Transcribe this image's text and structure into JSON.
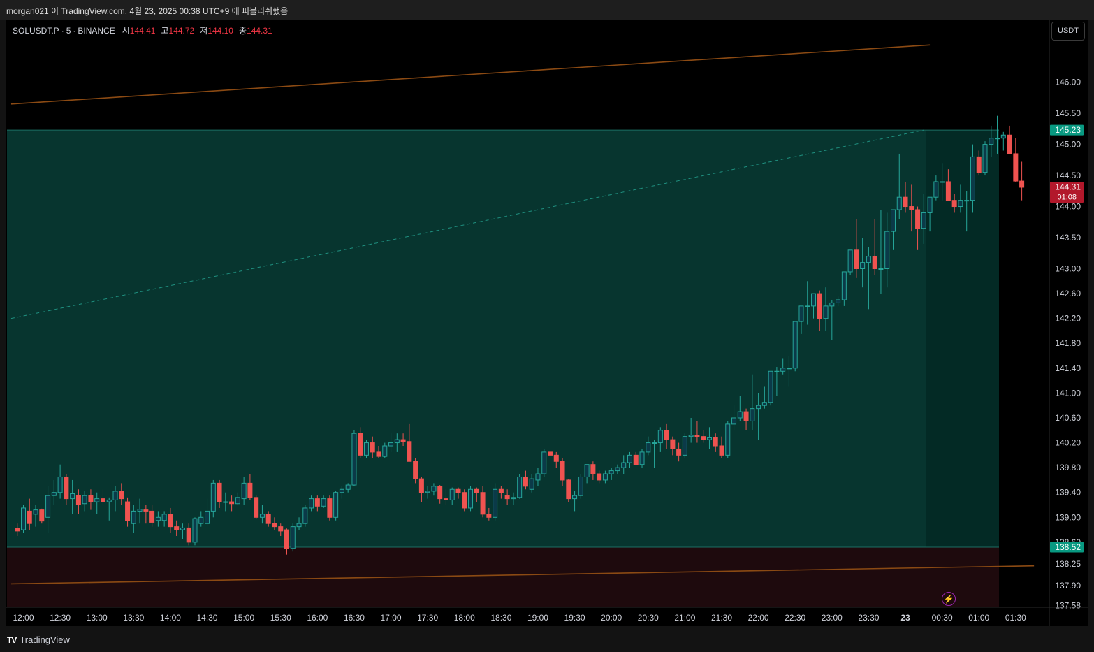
{
  "window": {
    "caption": "morgan021 이 TradingView.com, 4월 23, 2025 00:38 UTC+9 에 퍼블리쉬했음",
    "brand": "TradingView",
    "brand_logo": "TV"
  },
  "legend": {
    "symbol": "SOLUSDT.P",
    "interval": "5",
    "exchange": "BINANCE",
    "open_label": "시",
    "open": "144.41",
    "high_label": "고",
    "high": "144.72",
    "low_label": "저",
    "low": "144.10",
    "close_label": "종",
    "close": "144.31"
  },
  "toolbar": {
    "currency_label": "USDT"
  },
  "colors": {
    "up": "#26a69a",
    "down": "#ef5350",
    "profit_zone": "#07352f",
    "loss_zone": "#1e0a0d",
    "trend_line": "#8b4a13",
    "background": "#000000"
  },
  "icons": {
    "alert": "lightning-icon"
  },
  "chart_data": {
    "type": "candlestick",
    "symbol": "SOLUSDT.P",
    "interval_minutes": 5,
    "y_ticks": [
      "146.00",
      "145.50",
      "145.00",
      "144.50",
      "144.00",
      "143.50",
      "143.00",
      "142.60",
      "142.20",
      "141.80",
      "141.40",
      "141.00",
      "140.60",
      "140.20",
      "139.80",
      "139.40",
      "139.00",
      "138.60",
      "138.25",
      "137.90",
      "137.58"
    ],
    "x_ticks": [
      "12:00",
      "12:30",
      "13:00",
      "13:30",
      "14:00",
      "14:30",
      "15:00",
      "15:30",
      "16:00",
      "16:30",
      "17:00",
      "17:30",
      "18:00",
      "18:30",
      "19:00",
      "19:30",
      "20:00",
      "20:30",
      "21:00",
      "21:30",
      "22:00",
      "22:30",
      "23:00",
      "23:30",
      "23",
      "00:30",
      "01:00",
      "01:30"
    ],
    "price_labels": [
      {
        "text": "145.23",
        "kind": "target"
      },
      {
        "text": "144.31",
        "kind": "last",
        "countdown": "01:08"
      },
      {
        "text": "138.52",
        "kind": "stop"
      }
    ],
    "position": {
      "side": "long",
      "target": 145.23,
      "stop": 138.52
    },
    "trend_lines": [
      {
        "from": [
          "11:50",
          145.65
        ],
        "to": [
          "00:20",
          146.6
        ]
      },
      {
        "from": [
          "11:50",
          137.93
        ],
        "to": [
          "01:45",
          138.22
        ]
      }
    ],
    "dashed_line": {
      "from": [
        "11:50",
        142.2
      ],
      "to": [
        "00:15",
        145.23
      ]
    },
    "candles": [
      [
        138.82,
        138.9,
        138.7,
        138.78
      ],
      [
        138.8,
        139.2,
        138.75,
        139.15
      ],
      [
        139.1,
        139.3,
        138.8,
        138.9
      ],
      [
        139.05,
        139.2,
        138.85,
        139.12
      ],
      [
        139.12,
        139.14,
        138.9,
        138.94
      ],
      [
        139.0,
        139.5,
        138.75,
        139.35
      ],
      [
        139.35,
        139.6,
        139.2,
        139.4
      ],
      [
        139.4,
        139.85,
        139.3,
        139.65
      ],
      [
        139.65,
        139.7,
        139.2,
        139.3
      ],
      [
        139.3,
        139.6,
        139.05,
        139.38
      ],
      [
        139.35,
        139.45,
        139.05,
        139.2
      ],
      [
        139.22,
        139.42,
        139.1,
        139.35
      ],
      [
        139.35,
        139.45,
        139.12,
        139.25
      ],
      [
        139.25,
        139.4,
        139.05,
        139.3
      ],
      [
        139.3,
        139.45,
        139.2,
        139.25
      ],
      [
        139.25,
        139.32,
        138.95,
        139.28
      ],
      [
        139.28,
        139.5,
        139.1,
        139.42
      ],
      [
        139.42,
        139.55,
        139.2,
        139.3
      ],
      [
        139.25,
        139.32,
        138.85,
        138.95
      ],
      [
        138.9,
        139.2,
        138.75,
        139.1
      ],
      [
        139.1,
        139.3,
        138.9,
        139.13
      ],
      [
        139.12,
        139.2,
        138.9,
        139.1
      ],
      [
        139.1,
        139.2,
        138.85,
        138.92
      ],
      [
        138.95,
        139.1,
        138.85,
        139.0
      ],
      [
        138.95,
        139.1,
        138.85,
        139.05
      ],
      [
        139.05,
        139.15,
        138.75,
        138.85
      ],
      [
        138.85,
        138.95,
        138.7,
        138.8
      ],
      [
        138.8,
        138.9,
        138.65,
        138.83
      ],
      [
        138.83,
        138.9,
        138.55,
        138.6
      ],
      [
        138.6,
        139.0,
        138.55,
        138.98
      ],
      [
        138.9,
        139.1,
        138.85,
        139.0
      ],
      [
        138.9,
        139.3,
        138.85,
        139.1
      ],
      [
        139.1,
        139.6,
        139.0,
        139.55
      ],
      [
        139.55,
        139.6,
        139.15,
        139.25
      ],
      [
        139.25,
        139.4,
        139.1,
        139.25
      ],
      [
        139.25,
        139.35,
        139.1,
        139.22
      ],
      [
        139.22,
        139.4,
        139.2,
        139.32
      ],
      [
        139.3,
        139.65,
        139.2,
        139.55
      ],
      [
        139.55,
        139.7,
        139.28,
        139.32
      ],
      [
        139.32,
        139.35,
        138.98,
        139.0
      ],
      [
        139.0,
        139.2,
        138.9,
        139.05
      ],
      [
        139.05,
        139.1,
        138.85,
        138.9
      ],
      [
        138.9,
        139.0,
        138.8,
        138.85
      ],
      [
        138.85,
        138.9,
        138.7,
        138.78
      ],
      [
        138.8,
        138.82,
        138.4,
        138.5
      ],
      [
        138.5,
        138.9,
        138.45,
        138.85
      ],
      [
        138.85,
        139.0,
        138.8,
        138.9
      ],
      [
        138.9,
        139.2,
        138.85,
        139.15
      ],
      [
        139.15,
        139.35,
        139.1,
        139.3
      ],
      [
        139.3,
        139.35,
        139.1,
        139.18
      ],
      [
        139.18,
        139.35,
        139.15,
        139.3
      ],
      [
        139.3,
        139.35,
        138.95,
        139.0
      ],
      [
        139.0,
        139.42,
        138.95,
        139.4
      ],
      [
        139.4,
        139.5,
        139.3,
        139.45
      ],
      [
        139.45,
        139.55,
        139.4,
        139.52
      ],
      [
        139.52,
        140.4,
        139.5,
        140.35
      ],
      [
        140.35,
        140.45,
        139.95,
        140.0
      ],
      [
        140.0,
        140.25,
        139.95,
        140.2
      ],
      [
        140.2,
        140.3,
        139.95,
        140.05
      ],
      [
        140.05,
        140.15,
        139.95,
        139.98
      ],
      [
        139.98,
        140.2,
        139.95,
        140.15
      ],
      [
        140.15,
        140.35,
        140.05,
        140.2
      ],
      [
        140.2,
        140.35,
        140.05,
        140.25
      ],
      [
        140.25,
        140.35,
        140.15,
        140.22
      ],
      [
        140.22,
        140.5,
        139.9,
        139.9
      ],
      [
        139.9,
        139.95,
        139.55,
        139.62
      ],
      [
        139.62,
        139.65,
        139.25,
        139.4
      ],
      [
        139.4,
        139.5,
        139.3,
        139.42
      ],
      [
        139.42,
        139.55,
        139.35,
        139.5
      ],
      [
        139.5,
        139.52,
        139.22,
        139.3
      ],
      [
        139.3,
        139.45,
        139.2,
        139.28
      ],
      [
        139.28,
        139.48,
        139.2,
        139.45
      ],
      [
        139.45,
        139.48,
        139.3,
        139.4
      ],
      [
        139.4,
        139.45,
        139.1,
        139.15
      ],
      [
        139.15,
        139.5,
        139.1,
        139.45
      ],
      [
        139.45,
        139.48,
        139.25,
        139.4
      ],
      [
        139.4,
        139.5,
        139.0,
        139.05
      ],
      [
        139.05,
        139.15,
        138.95,
        139.0
      ],
      [
        139.0,
        139.55,
        138.95,
        139.45
      ],
      [
        139.45,
        139.5,
        139.3,
        139.4
      ],
      [
        139.35,
        139.45,
        139.2,
        139.3
      ],
      [
        139.3,
        139.4,
        139.2,
        139.32
      ],
      [
        139.32,
        139.7,
        139.3,
        139.65
      ],
      [
        139.65,
        139.75,
        139.45,
        139.5
      ],
      [
        139.45,
        139.7,
        139.4,
        139.62
      ],
      [
        139.6,
        139.8,
        139.5,
        139.7
      ],
      [
        139.7,
        140.1,
        139.65,
        140.05
      ],
      [
        140.05,
        140.15,
        139.9,
        140.0
      ],
      [
        140.0,
        140.05,
        139.8,
        139.9
      ],
      [
        139.9,
        139.95,
        139.5,
        139.6
      ],
      [
        139.6,
        139.62,
        139.25,
        139.3
      ],
      [
        139.3,
        139.42,
        139.1,
        139.35
      ],
      [
        139.35,
        139.7,
        139.3,
        139.65
      ],
      [
        139.65,
        139.85,
        139.55,
        139.85
      ],
      [
        139.85,
        139.9,
        139.6,
        139.7
      ],
      [
        139.7,
        139.75,
        139.55,
        139.6
      ],
      [
        139.6,
        139.75,
        139.55,
        139.7
      ],
      [
        139.7,
        139.8,
        139.6,
        139.75
      ],
      [
        139.75,
        139.85,
        139.7,
        139.8
      ],
      [
        139.8,
        140.0,
        139.7,
        139.88
      ],
      [
        139.88,
        140.05,
        139.8,
        140.0
      ],
      [
        140.0,
        140.05,
        139.85,
        139.85
      ],
      [
        139.85,
        140.1,
        139.8,
        140.05
      ],
      [
        140.05,
        140.3,
        140.0,
        140.2
      ],
      [
        140.2,
        140.25,
        139.8,
        140.2
      ],
      [
        140.2,
        140.45,
        140.05,
        140.4
      ],
      [
        140.4,
        140.5,
        140.1,
        140.25
      ],
      [
        140.25,
        140.3,
        140.0,
        140.1
      ],
      [
        140.1,
        140.2,
        139.9,
        140.0
      ],
      [
        140.0,
        140.35,
        139.95,
        140.3
      ],
      [
        140.3,
        140.6,
        140.2,
        140.32
      ],
      [
        140.32,
        140.55,
        140.2,
        140.3
      ],
      [
        140.3,
        140.4,
        140.2,
        140.25
      ],
      [
        140.25,
        140.45,
        140.1,
        140.28
      ],
      [
        140.28,
        140.35,
        140.05,
        140.15
      ],
      [
        140.15,
        140.3,
        139.95,
        140.0
      ],
      [
        140.0,
        140.55,
        139.95,
        140.5
      ],
      [
        140.5,
        140.8,
        140.4,
        140.6
      ],
      [
        140.6,
        140.95,
        140.55,
        140.7
      ],
      [
        140.7,
        140.75,
        140.4,
        140.55
      ],
      [
        140.55,
        141.3,
        140.4,
        140.75
      ],
      [
        140.75,
        141.0,
        140.25,
        140.8
      ],
      [
        140.8,
        141.1,
        140.75,
        140.85
      ],
      [
        140.85,
        141.35,
        140.8,
        141.35
      ],
      [
        141.35,
        141.42,
        140.95,
        141.35
      ],
      [
        141.35,
        141.55,
        141.3,
        141.4
      ],
      [
        141.4,
        141.6,
        141.1,
        141.4
      ],
      [
        141.4,
        142.15,
        141.35,
        142.15
      ],
      [
        142.15,
        142.3,
        141.95,
        142.4
      ],
      [
        142.4,
        142.8,
        142.1,
        142.4
      ],
      [
        142.4,
        142.6,
        142.2,
        142.6
      ],
      [
        142.6,
        142.65,
        142.0,
        142.2
      ],
      [
        142.2,
        142.7,
        142.0,
        142.4
      ],
      [
        142.4,
        142.5,
        141.85,
        142.45
      ],
      [
        142.45,
        142.55,
        142.4,
        142.5
      ],
      [
        142.5,
        142.95,
        142.4,
        142.95
      ],
      [
        142.95,
        143.3,
        142.9,
        143.3
      ],
      [
        143.3,
        143.8,
        142.85,
        143.0
      ],
      [
        143.0,
        143.5,
        142.7,
        143.1
      ],
      [
        143.1,
        143.35,
        142.35,
        143.2
      ],
      [
        143.2,
        143.8,
        142.9,
        143.0
      ],
      [
        143.0,
        143.95,
        142.6,
        143.0
      ],
      [
        143.0,
        143.9,
        142.7,
        143.6
      ],
      [
        143.6,
        143.85,
        143.3,
        143.95
      ],
      [
        143.95,
        144.85,
        143.8,
        144.15
      ],
      [
        144.15,
        144.4,
        143.9,
        144.0
      ],
      [
        144.0,
        144.35,
        143.6,
        143.95
      ],
      [
        143.95,
        144.0,
        143.3,
        143.65
      ],
      [
        143.65,
        144.2,
        143.4,
        143.9
      ],
      [
        143.9,
        144.1,
        143.6,
        144.15
      ],
      [
        144.15,
        144.5,
        144.1,
        144.4
      ],
      [
        144.4,
        144.7,
        144.1,
        144.4
      ],
      [
        144.4,
        144.6,
        144.1,
        144.1
      ],
      [
        144.1,
        144.2,
        143.9,
        144.0
      ],
      [
        144.0,
        144.35,
        143.9,
        144.1
      ],
      [
        144.1,
        144.25,
        143.6,
        144.1
      ],
      [
        144.1,
        145.0,
        143.9,
        144.8
      ],
      [
        144.8,
        144.9,
        144.5,
        144.55
      ],
      [
        144.55,
        145.05,
        144.5,
        145.0
      ],
      [
        145.0,
        145.3,
        144.8,
        145.1
      ],
      [
        145.1,
        145.46,
        144.85,
        145.1
      ],
      [
        145.1,
        145.2,
        144.9,
        145.15
      ],
      [
        145.15,
        145.3,
        144.85,
        144.85
      ],
      [
        144.85,
        145.1,
        144.4,
        144.41
      ],
      [
        144.41,
        144.72,
        144.1,
        144.31
      ]
    ]
  }
}
